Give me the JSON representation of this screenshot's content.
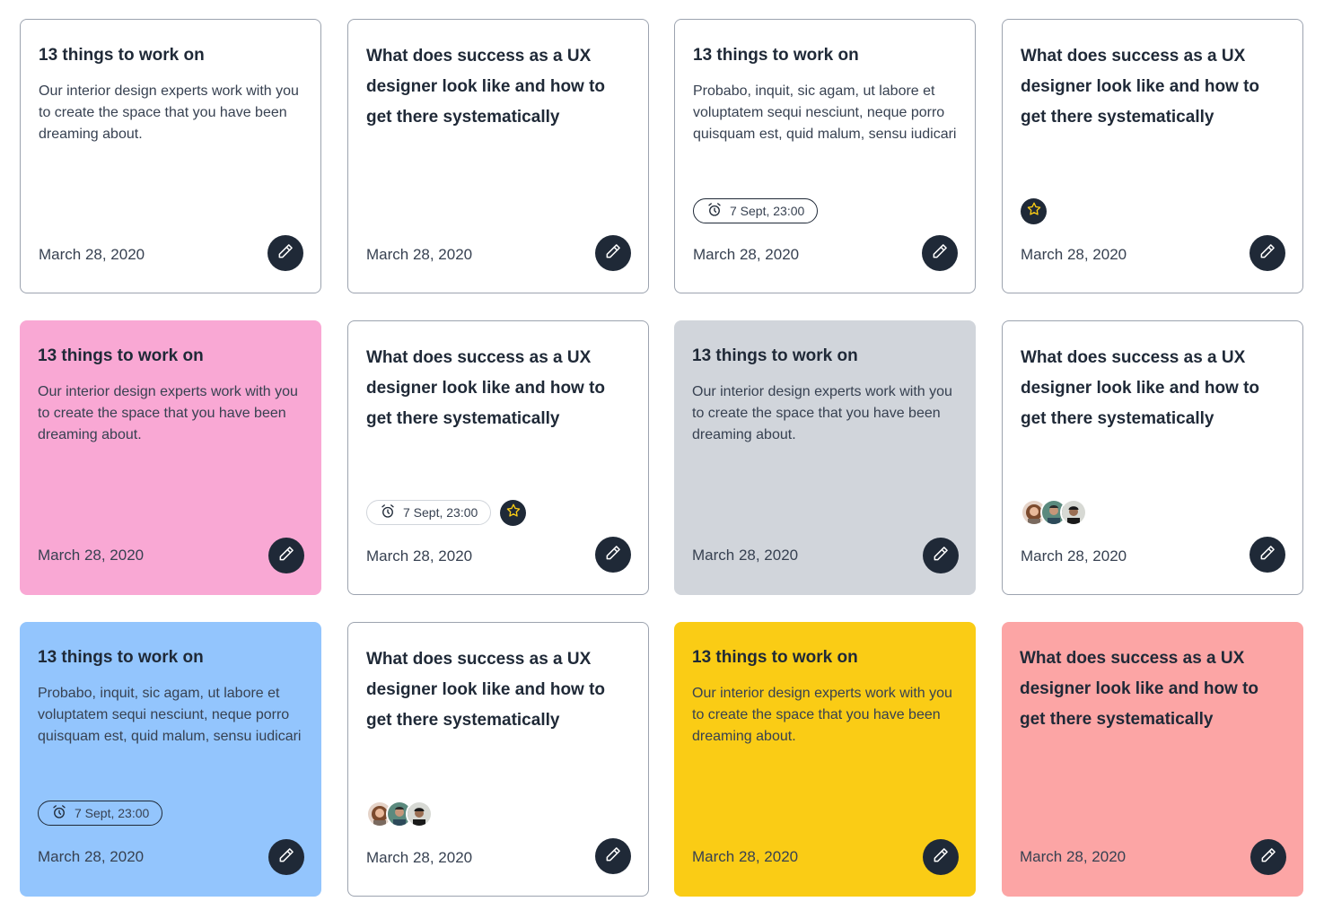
{
  "cards": [
    {
      "title": "13 things to work on",
      "description": "Our interior design experts work with you to create the space that you have been dreaming about.",
      "date": "March 28, 2020"
    },
    {
      "title": "What does success as a UX designer look like and how to get there systematically",
      "date": "March 28, 2020"
    },
    {
      "title": "13 things to work on",
      "description": "Probabo, inquit, sic agam, ut labore et voluptatem sequi nesciunt, neque porro quisquam est, quid malum, sensu iudicari",
      "reminder": "7 Sept, 23:00",
      "date": "March 28, 2020"
    },
    {
      "title": "What does success as a UX designer look like and how to get there systematically",
      "date": "March 28, 2020"
    },
    {
      "title": "13 things to work on",
      "description": "Our interior design experts work with you to create the space that you have been dreaming about.",
      "date": "March 28, 2020",
      "color": "#f9a8d4"
    },
    {
      "title": "What does success as a UX designer look like and how to get there systematically",
      "reminder": "7 Sept, 23:00",
      "date": "March 28, 2020"
    },
    {
      "title": "13 things to work on",
      "description": "Our interior design experts work with you to create the space that you have been dreaming about.",
      "date": "March 28, 2020",
      "color": "#d1d5db"
    },
    {
      "title": "What does success as a UX designer look like and how to get there systematically",
      "date": "March 28, 2020"
    },
    {
      "title": "13 things to work on",
      "description": "Probabo, inquit, sic agam, ut labore et voluptatem sequi nesciunt, neque porro quisquam est, quid malum, sensu iudicari",
      "reminder": "7 Sept, 23:00",
      "date": "March 28, 2020",
      "color": "#93c5fd"
    },
    {
      "title": "What does success as a UX designer look like and how to get there systematically",
      "date": "March 28, 2020"
    },
    {
      "title": "13 things to work on",
      "description": "Our interior design experts work with you to create the space that you have been dreaming about.",
      "date": "March 28, 2020",
      "color": "#facc15"
    },
    {
      "title": "What does success as a UX designer look like and how to get there systematically",
      "date": "March 28, 2020",
      "color": "#fca5a5"
    }
  ],
  "icons": {
    "edit": "pencil-icon",
    "reminder": "alarm-clock-icon",
    "favorite": "star-icon",
    "collaborators": "avatar"
  },
  "colors": {
    "dark": "#1f2937",
    "star": "#facc15"
  }
}
